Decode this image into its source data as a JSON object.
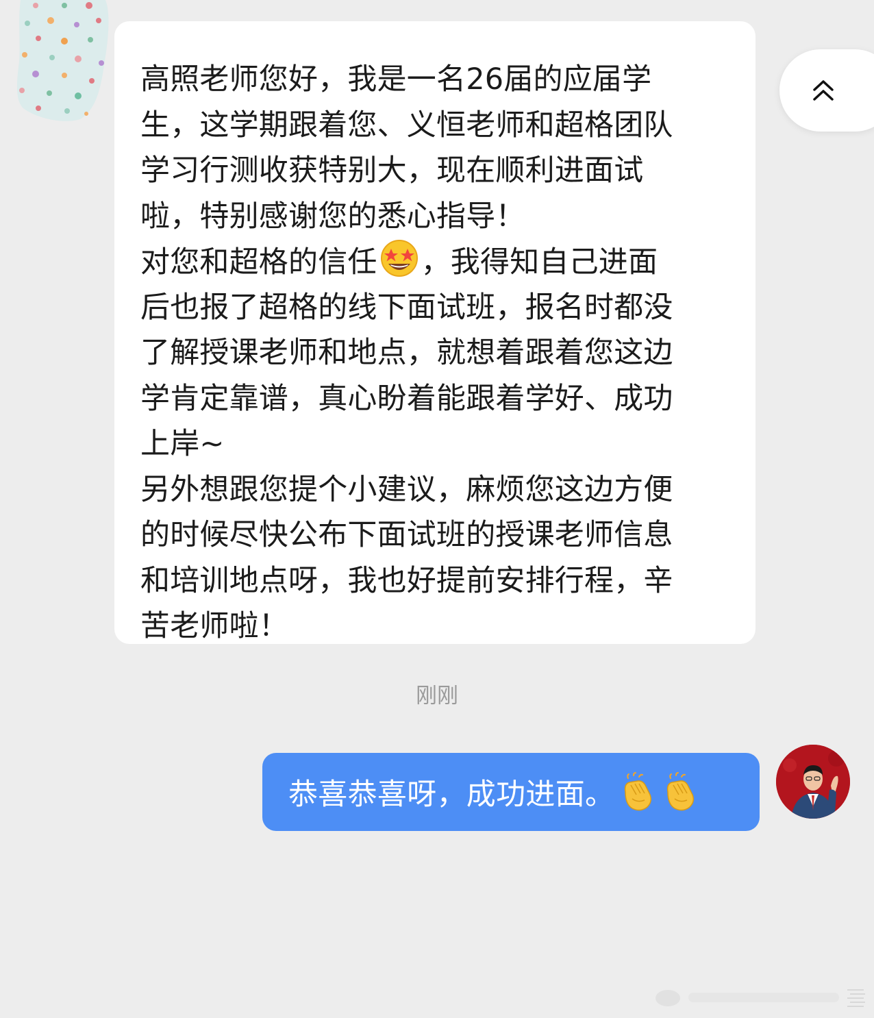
{
  "chat": {
    "incoming": {
      "lines": [
        "高照老师您好，我是一名26届的应届学",
        "生，这学期跟着您、义恒老师和超格团队",
        "学习行测收获特别大，现在顺利进面试",
        "啦，特别感谢您的悉心指导！",
        "对您和超格的信任",
        "，我得知自己进面",
        "后也报了超格的线下面试班，报名时都没",
        "了解授课老师和地点，就想着跟着您这边",
        "学肯定靠谱，真心盼着能跟着学好、成功",
        "上岸~",
        "另外想跟您提个小建议，麻烦您这边方便",
        "的时候尽快公布下面试班的授课老师信息",
        "和培训地点呀，我也好提前安排行程，辛",
        "苦老师啦！"
      ],
      "emoji": "star-struck-emoji"
    },
    "timestamp": "刚刚",
    "outgoing": {
      "text": "恭喜恭喜呀，成功进面。",
      "emoji": "clapping-hands-emoji"
    }
  },
  "colors": {
    "background": "#ededed",
    "incoming_bubble": "#ffffff",
    "outgoing_bubble": "#4d8ef5",
    "timestamp": "#9a9a9a"
  },
  "icons": {
    "scroll_top": "double-chevron-up-icon"
  }
}
